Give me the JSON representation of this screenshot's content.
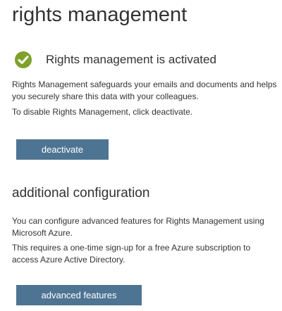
{
  "page": {
    "title": "rights management"
  },
  "status": {
    "icon": "check-circle-icon",
    "icon_color": "#7ea229",
    "text": "Rights management is activated"
  },
  "description": {
    "line1": "Rights Management safeguards your emails and documents and helps you securely share this data with your colleagues.",
    "line2": "To disable Rights Management, click deactivate."
  },
  "deactivate_button": {
    "label": "deactivate"
  },
  "additional": {
    "title": "additional configuration",
    "para1": "You can configure advanced features for Rights Management using Microsoft Azure.",
    "para2": "This requires a one-time sign-up for a free Azure subscription to access Azure Active Directory.",
    "button_label": "advanced features"
  },
  "colors": {
    "button_bg": "#4e7493",
    "text": "#333333",
    "success": "#7ea229"
  }
}
